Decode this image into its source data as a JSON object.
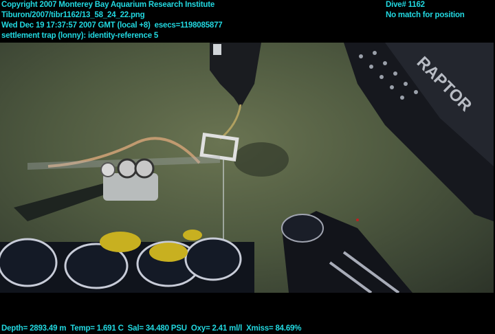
{
  "header": {
    "copyright": "Copyright 2007 Monterey Bay Aquarium Research Institute",
    "file_path": "Tiburon/2007/tibr1162/13_58_24_22.png",
    "timestamp": "Wed Dec 19 17:37:57 2007 GMT (local +8)  esecs=1198085877",
    "annotation": "settlement trap (lonny): identity-reference 5",
    "dive": "Dive# 1162",
    "position_status": "No match for position"
  },
  "video": {
    "vehicle_label": "RAPTOR"
  },
  "footer": {
    "telemetry": "Depth= 2893.49 m  Temp= 1.691 C  Sal= 34.480 PSU  Oxy= 2.41 ml/l  Xmiss= 84.69%"
  },
  "colors": {
    "overlay_text": "#22d8e0",
    "background": "#000000"
  }
}
